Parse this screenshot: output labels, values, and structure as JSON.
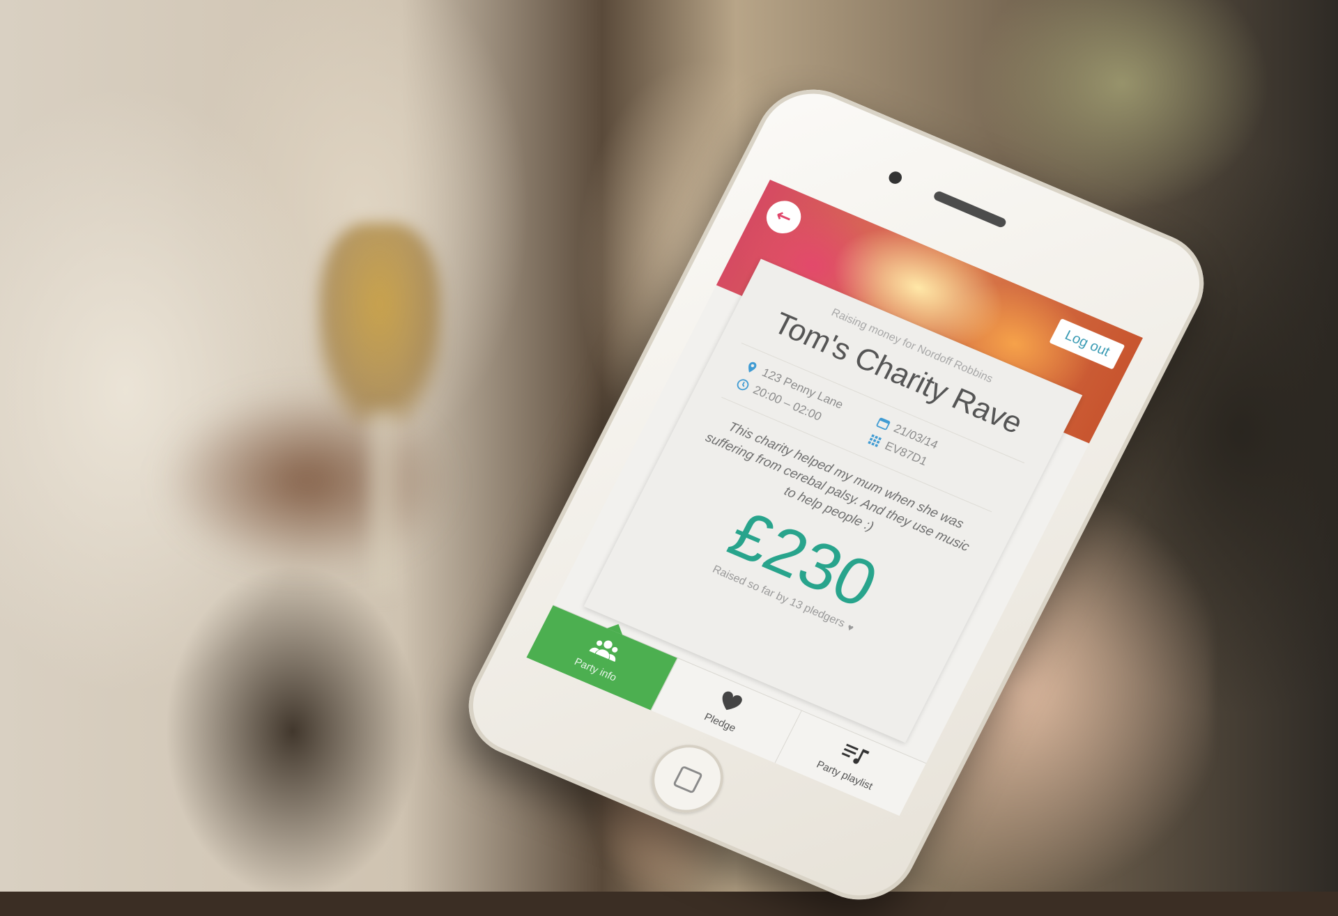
{
  "app": {
    "header": {
      "logout_label": "Log out",
      "back_icon": "arrow-left-icon"
    },
    "event": {
      "subtitle": "Raising money for Nordoff Robbins",
      "title": "Tom's Charity Rave",
      "location": "123 Penny Lane",
      "date": "21/03/14",
      "time": "20:00 – 02:00",
      "code": "EV87D1",
      "description": "This charity helped my mum when she was suffering from cerebal palsy. And they use music to help people :)",
      "amount": "£230",
      "raised_text": "Raised so far by 13 pledgers"
    },
    "tabs": [
      {
        "label": "Party info",
        "icon": "group-icon",
        "active": true
      },
      {
        "label": "Pledge",
        "icon": "heart-icon",
        "active": false
      },
      {
        "label": "Party playlist",
        "icon": "playlist-icon",
        "active": false
      }
    ],
    "colors": {
      "accent_green": "#4caf50",
      "amount_teal": "#28a48c",
      "info_blue": "#3f9bd3",
      "logout_blue": "#3a9bb4"
    }
  }
}
